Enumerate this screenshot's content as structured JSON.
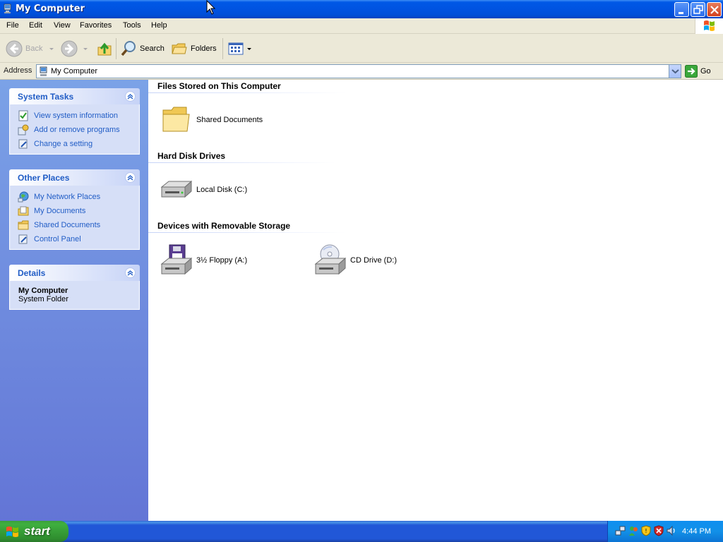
{
  "window": {
    "title": "My Computer"
  },
  "menu": [
    "File",
    "Edit",
    "View",
    "Favorites",
    "Tools",
    "Help"
  ],
  "toolbar": {
    "back_label": "Back",
    "search_label": "Search",
    "folders_label": "Folders"
  },
  "address": {
    "label": "Address",
    "value": "My Computer",
    "go_label": "Go"
  },
  "left": {
    "system_tasks": {
      "title": "System Tasks",
      "items": [
        "View system information",
        "Add or remove programs",
        "Change a setting"
      ]
    },
    "other_places": {
      "title": "Other Places",
      "items": [
        "My Network Places",
        "My Documents",
        "Shared Documents",
        "Control Panel"
      ]
    },
    "details": {
      "title": "Details",
      "name": "My Computer",
      "type": "System Folder"
    }
  },
  "content": {
    "groups": [
      {
        "title": "Files Stored on This Computer",
        "items": [
          "Shared Documents"
        ]
      },
      {
        "title": "Hard Disk Drives",
        "items": [
          "Local Disk (C:)"
        ]
      },
      {
        "title": "Devices with Removable Storage",
        "items": [
          "3½ Floppy (A:)",
          "CD Drive (D:)"
        ]
      }
    ]
  },
  "taskbar": {
    "start_label": "start",
    "clock": "4:44 PM"
  },
  "colors": {
    "titlebar": "#0053e1",
    "taskpane_link": "#215dc6",
    "start_green": "#3fb03f"
  }
}
